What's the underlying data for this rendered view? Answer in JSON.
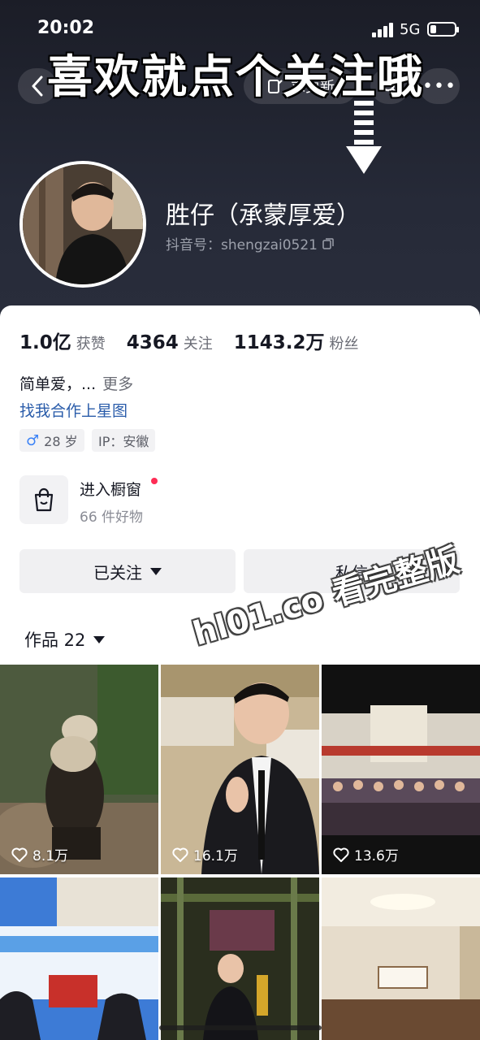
{
  "status_bar": {
    "time": "20:02",
    "network": "5G",
    "battery_level": 0.25
  },
  "top_nav": {
    "update_label": "求更新"
  },
  "overlay_text": "喜欢就点个关注哦",
  "watermark_text": "hl01.co 看完整版",
  "profile": {
    "nickname": "胜仔（承蒙厚爱）",
    "douyin_id": "抖音号：shengzai0521",
    "stats": {
      "likes_value": "1.0亿",
      "likes_label": "获赞",
      "following_value": "4364",
      "following_label": "关注",
      "followers_value": "1143.2万",
      "followers_label": "粉丝"
    },
    "bio": "简单爱，...",
    "bio_more": "更多",
    "cooperation_link": "找我合作上星图",
    "tags": {
      "gender_symbol": "♂",
      "age": "28 岁",
      "ip": "IP：安徽"
    }
  },
  "shop": {
    "title": "进入橱窗",
    "subtitle": "66 件好物"
  },
  "actions": {
    "followed_label": "已关注",
    "message_label": "私信"
  },
  "works_tab": {
    "label": "作品 22"
  },
  "videos": [
    {
      "likes": "8.1万",
      "theme": "panda"
    },
    {
      "likes": "16.1万",
      "theme": "man-suit"
    },
    {
      "likes": "13.6万",
      "theme": "village-crowd"
    },
    {
      "likes": "",
      "theme": "banner-event"
    },
    {
      "likes": "",
      "theme": "man-trophy"
    },
    {
      "likes": "",
      "theme": "meeting-room"
    }
  ],
  "colors": {
    "header_bg": "#1b1d27",
    "link_blue": "#2a5caa",
    "dot_red": "#fe2c55",
    "gender_blue": "#3b82f6"
  }
}
